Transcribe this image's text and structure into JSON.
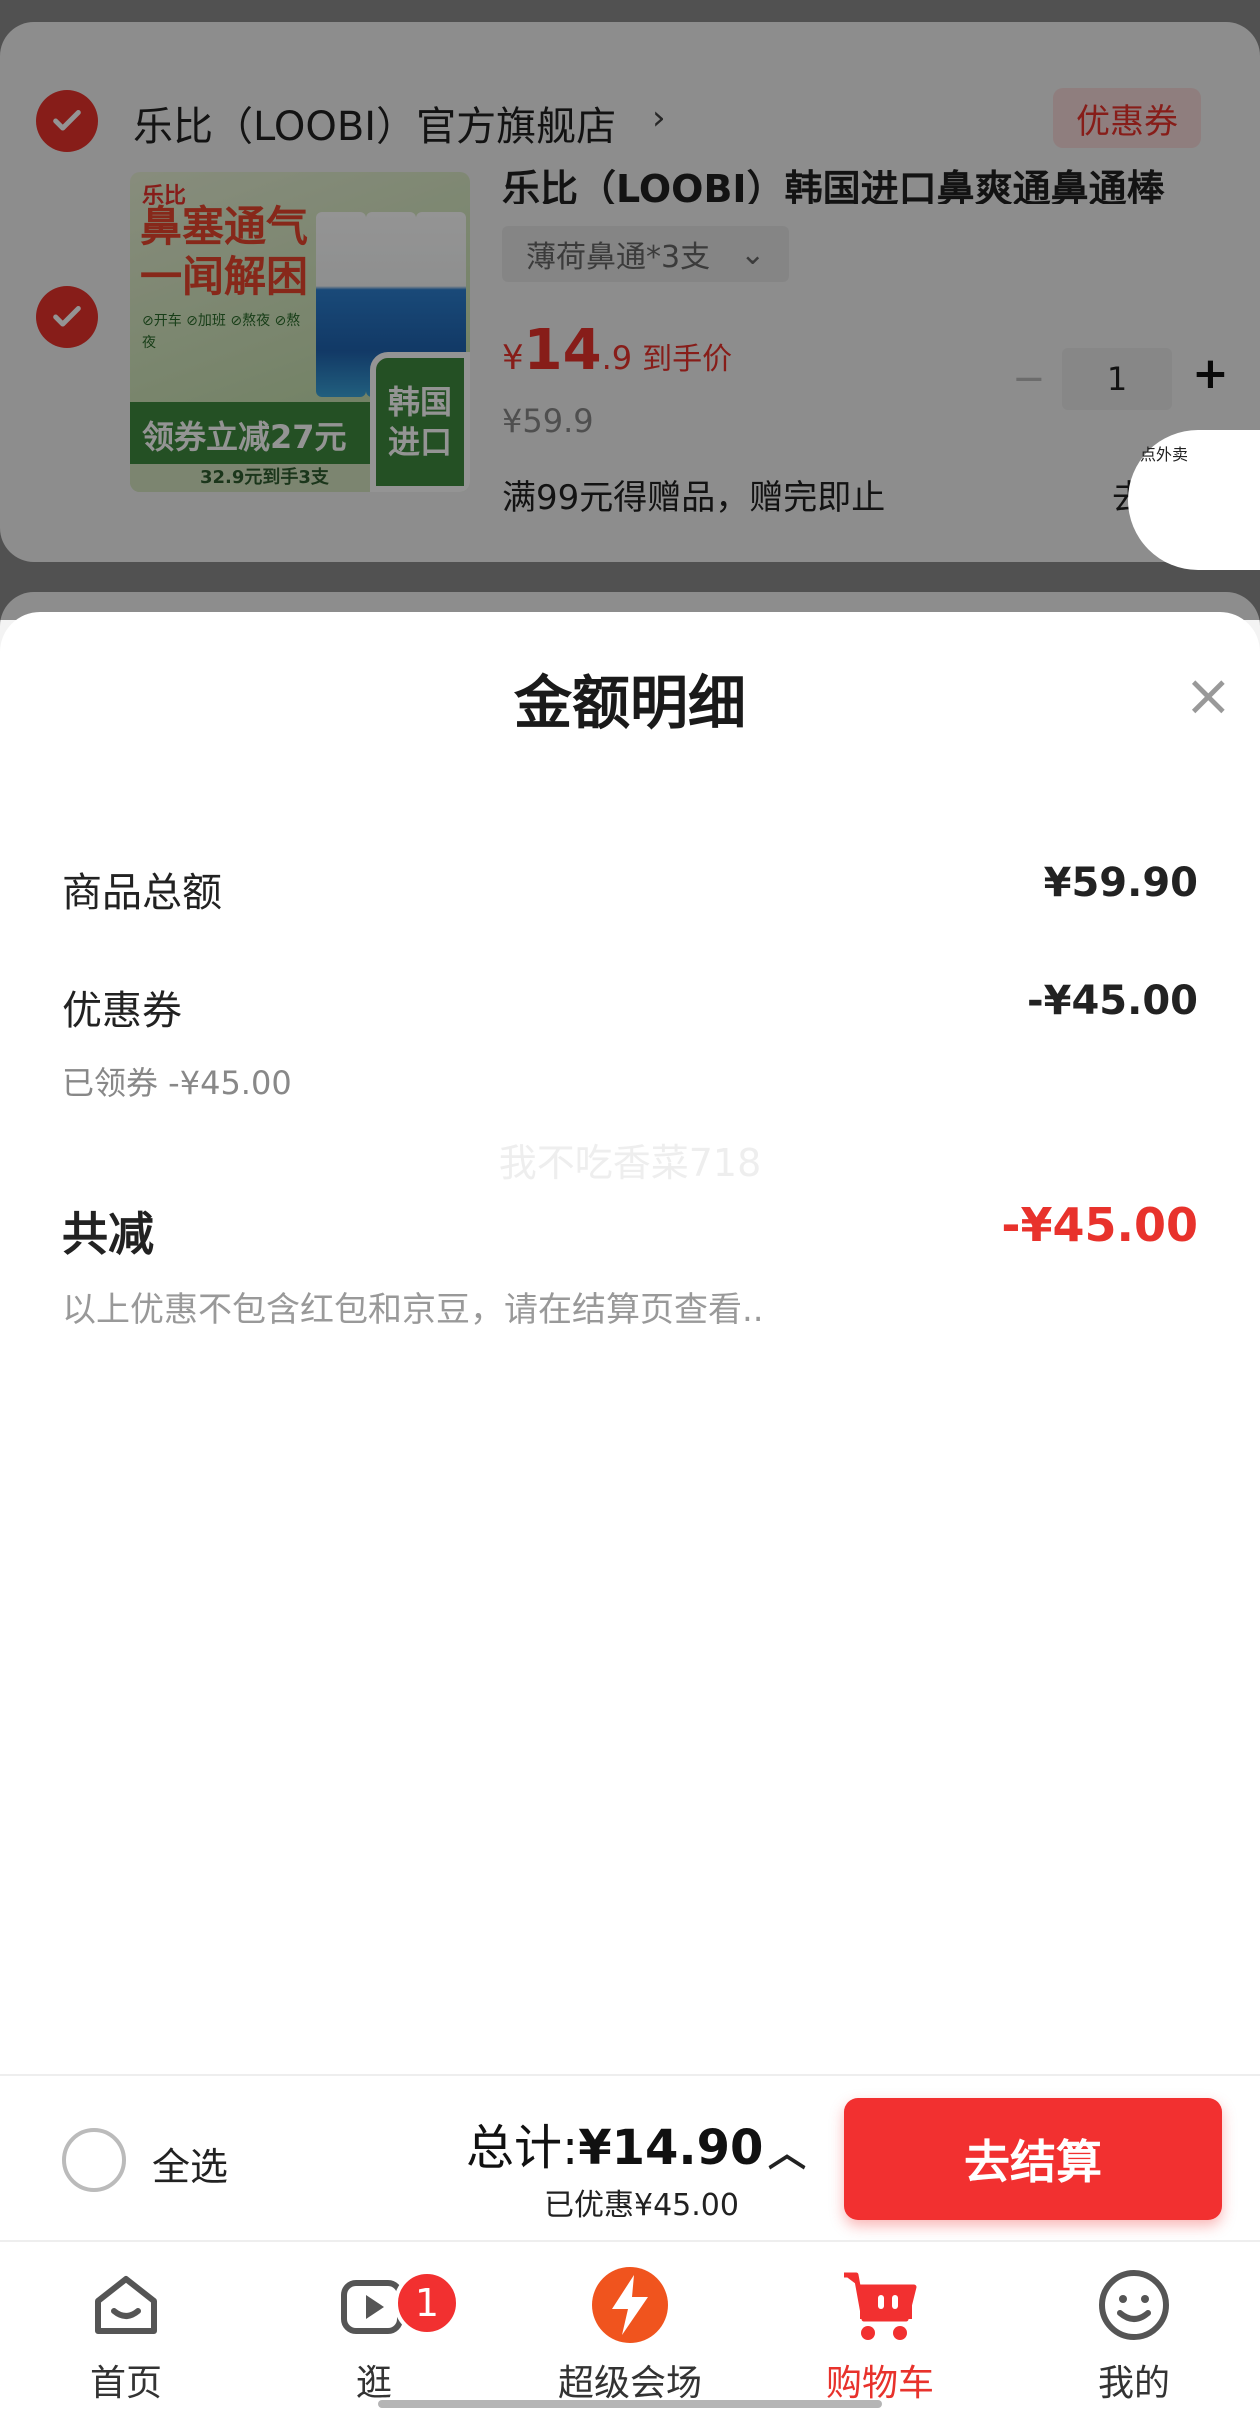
{
  "cart": {
    "store_name": "乐比（LOOBI）官方旗舰店",
    "store_arrow": "›",
    "coupon_label": "优惠券",
    "product": {
      "title": "乐比（LOOBI）韩国进口鼻爽通鼻通棒",
      "variant": "薄荷鼻通*3支",
      "variant_caret": "⌄",
      "price_yen": "¥",
      "price_int": "14",
      "price_dec": ".9",
      "price_tag": "到手价",
      "price_old": "¥59.9",
      "promo": "满99元得赠品，赠完即止",
      "promo_more": "去",
      "quantity": "1",
      "qty_minus": "−",
      "qty_plus": "+",
      "image_text": {
        "brand": "乐比",
        "slogan": "鼻塞通气一闻解困",
        "chips": "⊘开车 ⊘加班 ⊘熬夜 ⊘熬夜",
        "strip": "领券立减27元",
        "substrip": "32.9元到手3支",
        "korea": "韩国进口"
      }
    },
    "takeout_label": "点外卖"
  },
  "sheet": {
    "title": "金额明细",
    "close": "×",
    "rows": [
      {
        "label": "商品总额",
        "value": "¥59.90"
      },
      {
        "label": "优惠券",
        "value": "-¥45.00",
        "sub": "已领券 -¥45.00"
      }
    ],
    "watermark": "我不吃香菜718",
    "total_label": "共减",
    "total_value": "-¥45.00",
    "note": "以上优惠不包含红包和京豆，请在结算页查看.."
  },
  "checkout_bar": {
    "select_all": "全选",
    "total_prefix": "总计:",
    "total_amount": "¥14.90",
    "saved": "已优惠¥45.00",
    "caret": "︿",
    "checkout_button": "去结算"
  },
  "tabs": [
    {
      "label": "首页",
      "icon": "home-icon"
    },
    {
      "label": "逛",
      "icon": "video-icon",
      "badge": "1"
    },
    {
      "label": "超级会场",
      "icon": "flash-sale-icon"
    },
    {
      "label": "购物车",
      "icon": "cart-icon",
      "active": true
    },
    {
      "label": "我的",
      "icon": "profile-icon"
    }
  ],
  "colors": {
    "accent": "#e8322c",
    "checkout_button": "#f23030",
    "text_primary": "#222222",
    "text_secondary": "#888888"
  }
}
